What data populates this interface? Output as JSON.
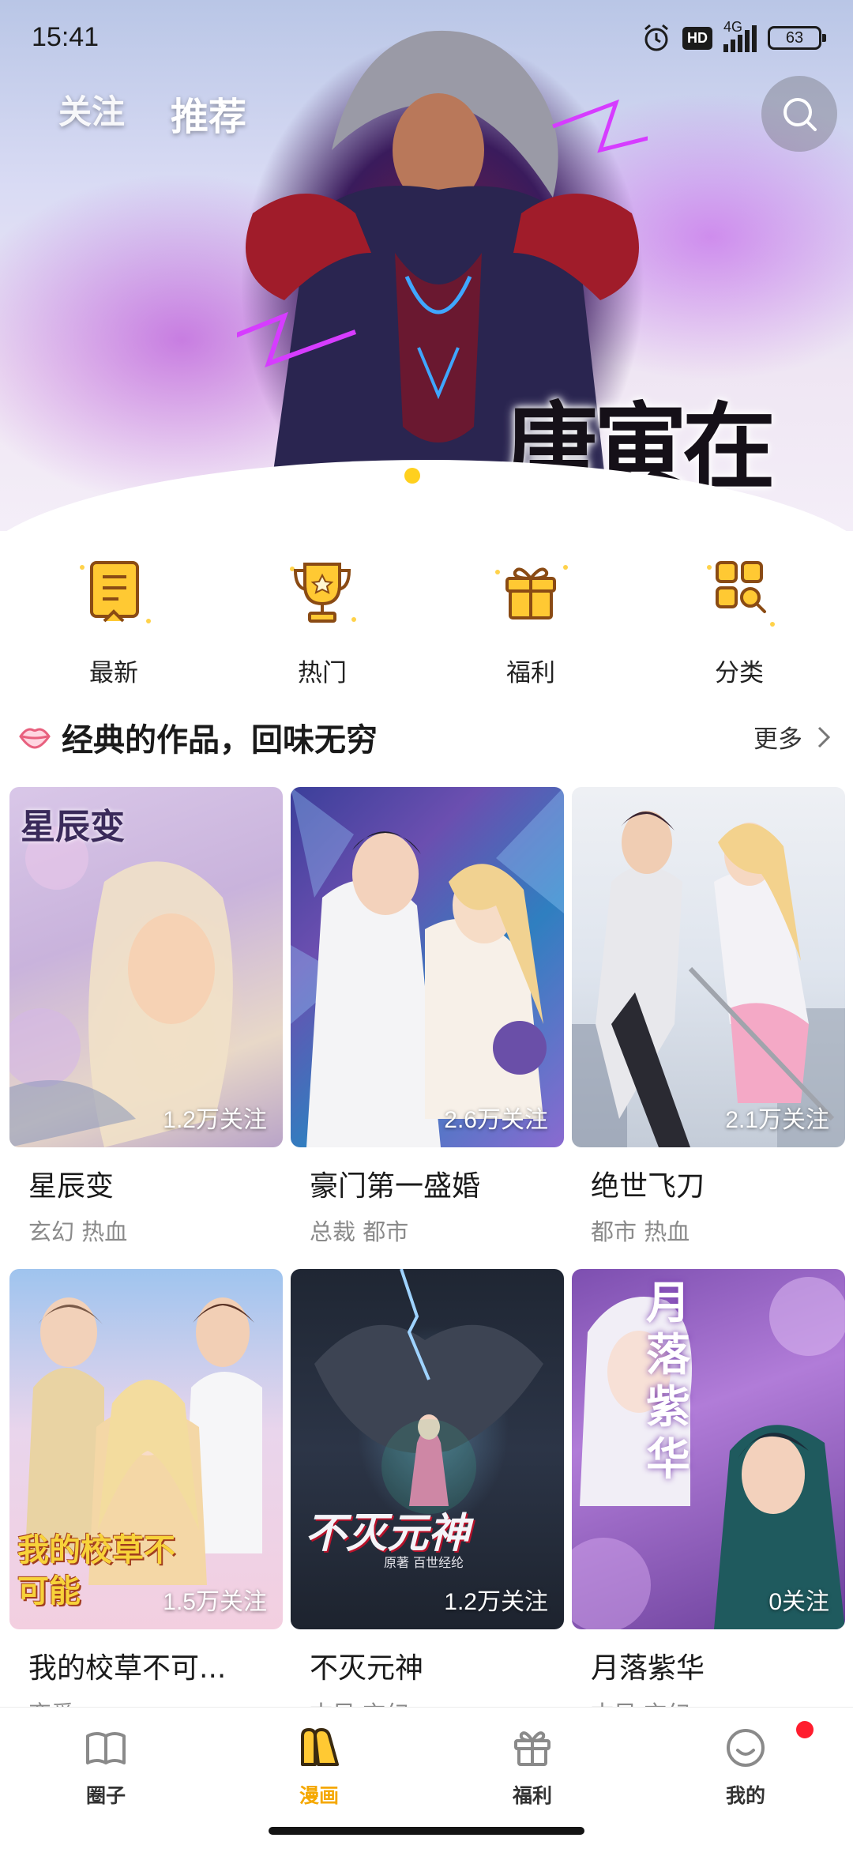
{
  "status_bar": {
    "time": "15:41",
    "network": "4G",
    "hd": "HD",
    "battery": "63"
  },
  "top_tabs": [
    {
      "label": "关注",
      "active": false
    },
    {
      "label": "推荐",
      "active": true
    }
  ],
  "banner": {
    "title_art": "唐寅在异界",
    "dots": 2,
    "active_dot": 0
  },
  "quick_entries": [
    {
      "label": "最新",
      "icon": "book-icon"
    },
    {
      "label": "热门",
      "icon": "trophy-icon"
    },
    {
      "label": "福利",
      "icon": "gift-icon"
    },
    {
      "label": "分类",
      "icon": "category-icon"
    }
  ],
  "section": {
    "title": "经典的作品，回味无穷",
    "more": "更多"
  },
  "cards": [
    {
      "title": "星辰变",
      "tags": "玄幻 热血",
      "follows": "1.2万关注",
      "cover_text": "星辰变"
    },
    {
      "title": "豪门第一盛婚",
      "tags": "总裁 都市",
      "follows": "2.6万关注",
      "cover_text": ""
    },
    {
      "title": "绝世飞刀",
      "tags": "都市 热血",
      "follows": "2.1万关注",
      "cover_text": ""
    },
    {
      "title": "我的校草不可...",
      "tags": "恋爱",
      "follows": "1.5万关注",
      "cover_text": "我的校草不可能"
    },
    {
      "title": "不灭元神",
      "tags": "古风 玄幻",
      "follows": "1.2万关注",
      "cover_text": "不灭元神",
      "cover_sub": "原著 百世经纶"
    },
    {
      "title": "月落紫华",
      "tags": "古风 玄幻",
      "follows": "0关注",
      "cover_text": "月落紫华"
    }
  ],
  "bottom_nav": [
    {
      "label": "圈子",
      "icon": "circle-book-icon",
      "active": false
    },
    {
      "label": "漫画",
      "icon": "comic-icon",
      "active": true
    },
    {
      "label": "福利",
      "icon": "gift-icon",
      "active": false
    },
    {
      "label": "我的",
      "icon": "smile-icon",
      "active": false,
      "badge": true
    }
  ],
  "colors": {
    "accent": "#f5a800",
    "icon_yellow": "#ffc933",
    "icon_brown": "#8a4b14",
    "badge_red": "#ff1d2e"
  }
}
